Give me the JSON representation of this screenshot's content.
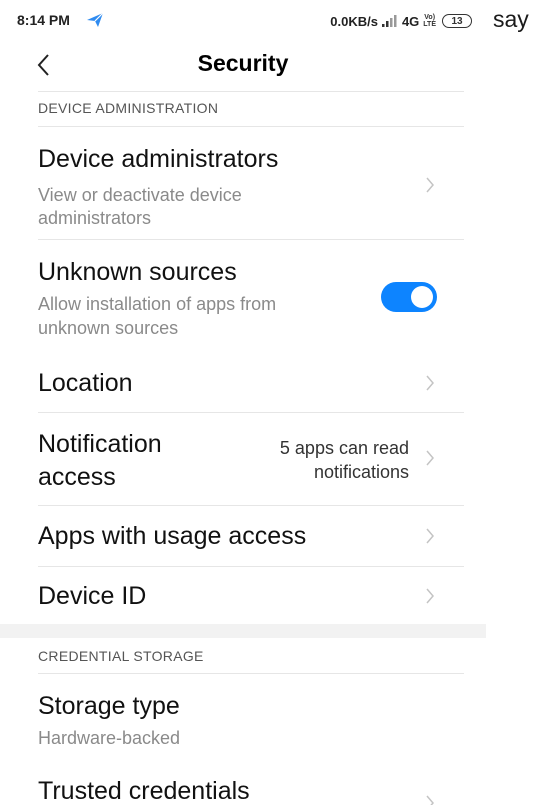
{
  "status_bar": {
    "time": "8:14 PM",
    "network_speed": "0.0KB/s",
    "network_type": "4G",
    "volte_top": "Vo)",
    "volte_bottom": "LTE",
    "battery": "13"
  },
  "outside_text": "say",
  "header": {
    "title": "Security"
  },
  "sections": {
    "device_admin": {
      "label": "DEVICE ADMINISTRATION",
      "items": {
        "device_administrators": {
          "title": "Device administrators",
          "subtitle_line1": "View or deactivate device",
          "subtitle_line2": "administrators"
        },
        "unknown_sources": {
          "title": "Unknown sources",
          "subtitle_line1": "Allow installation of apps from",
          "subtitle_line2": "unknown sources",
          "enabled": true
        },
        "location": {
          "title": "Location"
        },
        "notification_access": {
          "title_line1": "Notification",
          "title_line2": "access",
          "value_line1": "5 apps can read",
          "value_line2": "notifications"
        },
        "usage_access": {
          "title": "Apps with usage access"
        },
        "device_id": {
          "title": "Device ID"
        }
      }
    },
    "credential_storage": {
      "label": "CREDENTIAL STORAGE",
      "items": {
        "storage_type": {
          "title": "Storage type",
          "subtitle": "Hardware-backed"
        },
        "trusted_credentials": {
          "title": "Trusted credentials"
        }
      }
    }
  },
  "colors": {
    "accent": "#0d84ff",
    "subtitle": "#8a8a8a",
    "divider": "#e6e6e6"
  }
}
